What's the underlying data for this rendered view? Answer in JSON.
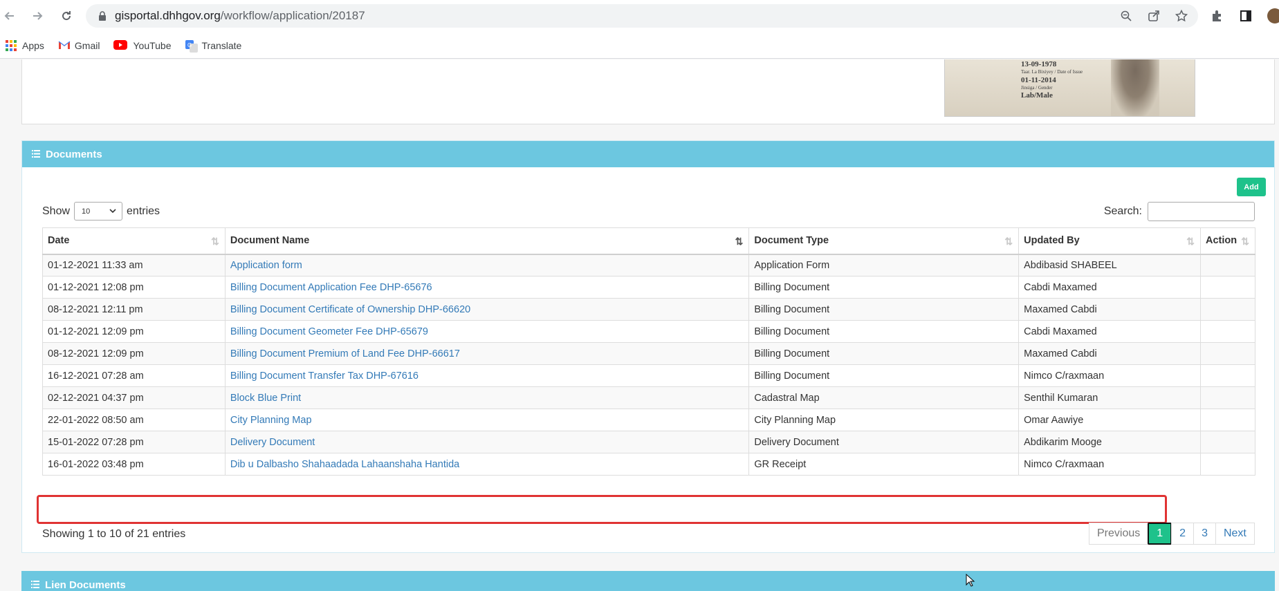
{
  "browser": {
    "url_host": "gisportal.dhhgov.org",
    "url_path": "/workflow/application/20187",
    "bookmarks": [
      {
        "label": "Apps",
        "icon": "apps-grid-icon"
      },
      {
        "label": "Gmail",
        "icon": "gmail-icon"
      },
      {
        "label": "YouTube",
        "icon": "youtube-icon"
      },
      {
        "label": "Translate",
        "icon": "translate-icon"
      }
    ]
  },
  "id_card": {
    "dob": "13-09-1978",
    "issue_label": "Taar. La Bixiyey / Date of Issue",
    "issue_date": "01-11-2014",
    "gender_label": "Jinsiga / Gender",
    "gender": "Lab/Male"
  },
  "documents": {
    "title": "Documents",
    "add_label": "Add",
    "show_label": "Show",
    "entries_value": "10",
    "entries_label": "entries",
    "search_label": "Search:",
    "columns": [
      "Date",
      "Document Name",
      "Document Type",
      "Updated By",
      "Action"
    ],
    "rows": [
      {
        "date": "01-12-2021 11:33 am",
        "name": "Application form",
        "type": "Application Form",
        "by": "Abdibasid SHABEEL"
      },
      {
        "date": "01-12-2021 12:08 pm",
        "name": "Billing Document Application Fee DHP-65676",
        "type": "Billing Document",
        "by": "Cabdi Maxamed"
      },
      {
        "date": "08-12-2021 12:11 pm",
        "name": "Billing Document Certificate of Ownership DHP-66620",
        "type": "Billing Document",
        "by": "Maxamed Cabdi"
      },
      {
        "date": "01-12-2021 12:09 pm",
        "name": "Billing Document Geometer Fee DHP-65679",
        "type": "Billing Document",
        "by": "Cabdi Maxamed"
      },
      {
        "date": "08-12-2021 12:09 pm",
        "name": "Billing Document Premium of Land Fee DHP-66617",
        "type": "Billing Document",
        "by": "Maxamed Cabdi"
      },
      {
        "date": "16-12-2021 07:28 am",
        "name": "Billing Document Transfer Tax DHP-67616",
        "type": "Billing Document",
        "by": "Nimco C/raxmaan"
      },
      {
        "date": "02-12-2021 04:37 pm",
        "name": "Block Blue Print",
        "type": "Cadastral Map",
        "by": "Senthil Kumaran"
      },
      {
        "date": "22-01-2022 08:50 am",
        "name": "City Planning Map",
        "type": "City Planning Map",
        "by": "Omar Aawiye"
      },
      {
        "date": "15-01-2022 07:28 pm",
        "name": "Delivery Document",
        "type": "Delivery Document",
        "by": "Abdikarim Mooge"
      },
      {
        "date": "16-01-2022 03:48 pm",
        "name": "Dib u Dalbasho Shahaadada Lahaanshaha Hantida",
        "type": "GR Receipt",
        "by": "Nimco C/raxmaan"
      }
    ],
    "info": "Showing 1 to 10 of 21 entries",
    "pager": {
      "prev": "Previous",
      "pages": [
        "1",
        "2",
        "3"
      ],
      "next": "Next"
    }
  },
  "lien": {
    "title": "Lien Documents"
  },
  "colors": {
    "panel_header": "#6cc7e0",
    "accent_green": "#1ec28b",
    "link": "#337ab7",
    "highlight": "#e03333"
  }
}
